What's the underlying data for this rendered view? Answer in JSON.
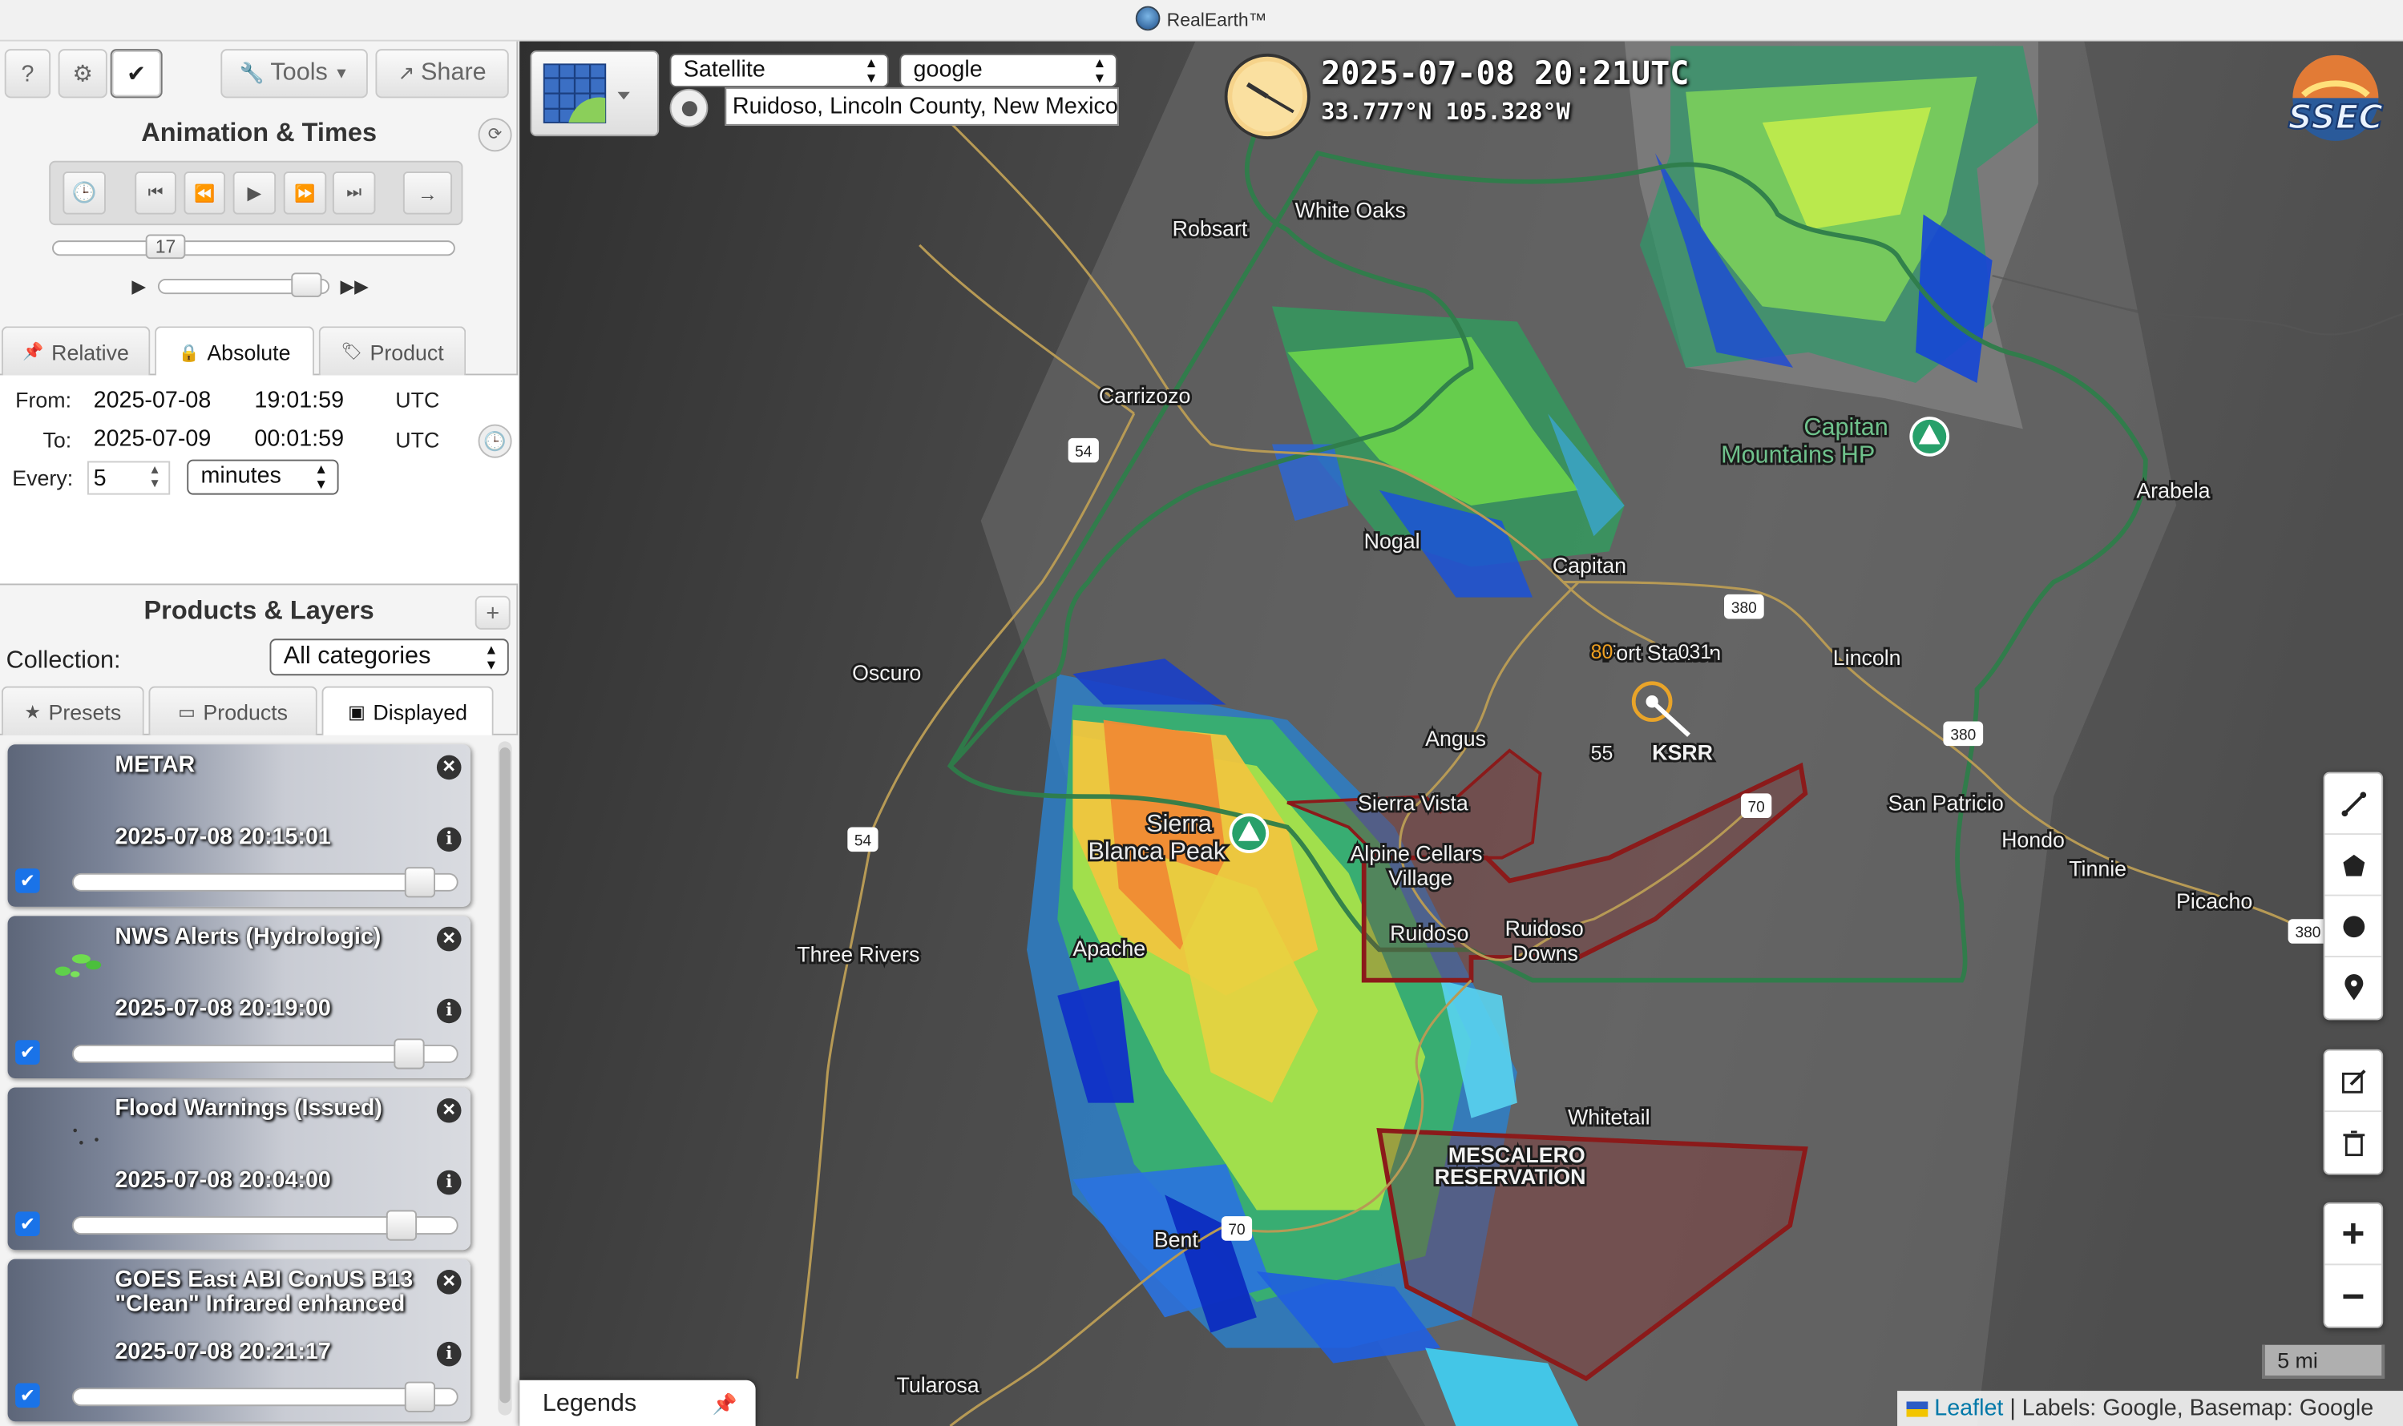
{
  "window": {
    "title": "RealEarth™"
  },
  "toolbar": {
    "help": "?",
    "settings": "⚙",
    "check": "✔",
    "tools": "Tools",
    "share": "Share"
  },
  "animation": {
    "title": "Animation & Times",
    "frame": "17",
    "tabs": [
      "Relative",
      "Absolute",
      "Product"
    ],
    "from_label": "From:",
    "to_label": "To:",
    "every_label": "Every:",
    "from_date": "2025-07-08",
    "from_time": "19:01:59",
    "to_date": "2025-07-09",
    "to_time": "00:01:59",
    "tz": "UTC",
    "every_value": "5",
    "every_unit": "minutes"
  },
  "products": {
    "title": "Products & Layers",
    "collection_label": "Collection:",
    "collection_value": "All categories",
    "tabs": [
      "Presets",
      "Products",
      "Displayed"
    ],
    "layers": [
      {
        "name": "METAR",
        "time": "2025-07-08 20:15:01",
        "opacity": 0.93
      },
      {
        "name": "NWS Alerts (Hydrologic)",
        "time": "2025-07-08 20:19:00",
        "opacity": 0.9
      },
      {
        "name": "Flood Warnings (Issued)",
        "time": "2025-07-08 20:04:00",
        "opacity": 0.88
      },
      {
        "name": "GOES East ABI ConUS B13 \"Clean\" Infrared enhanced",
        "time": "2025-07-08 20:21:17",
        "opacity": 0.93
      }
    ]
  },
  "map": {
    "basemap_type": "Satellite",
    "basemap_provider": "google",
    "location": "Ruidoso, Lincoln County, New Mexico",
    "timestamp": "2025-07-08  20:21UTC",
    "coords": "33.777°N 105.328°W",
    "logo": "SSEC",
    "scale": "5 mi",
    "legends": "Legends",
    "attribution_link": "Leaflet",
    "attribution_text": " | Labels: Google, Basemap: Google",
    "places": {
      "white_oaks": "White Oaks",
      "robsart": "Robsart",
      "carrizozo": "Carrizozo",
      "nogal": "Nogal",
      "capitan": "Capitan",
      "capitan_mtns": "Capitan",
      "capitan_mtns2": "Mountains HP",
      "arabela": "Arabela",
      "oscuro": "Oscuro",
      "fort_stanton": "Fort Stanton",
      "lincoln": "Lincoln",
      "angus": "Angus",
      "ksrr": "KSRR",
      "sierra_vista": "Sierra Vista",
      "sierra_blanca": "Sierra",
      "sierra_blanca2": "Blanca Peak",
      "alpine": "Alpine Cellars",
      "alpine2": "Village",
      "ruidoso": "Ruidoso",
      "ruidoso_downs": "Ruidoso",
      "ruidoso_downs2": "Downs",
      "san_patricio": "San Patricio",
      "hondo": "Hondo",
      "tinnie": "Tinnie",
      "picacho": "Picacho",
      "three_rivers": "Three Rivers",
      "apache": "Apache",
      "whitetail": "Whitetail",
      "mescalero": "MESCALERO",
      "mescalero2": "RESERVATION",
      "bent": "Bent",
      "tularosa": "Tularosa",
      "station_55": "55",
      "station_80": "80",
      "station_031": "031"
    },
    "shields": {
      "us54a": "54",
      "us54b": "54",
      "us380a": "380",
      "us380b": "380",
      "us380c": "380",
      "us70a": "70",
      "us70b": "70"
    },
    "colors": {
      "alert_fill": "#8b2a2a",
      "warning_outline": "#8b1a1a",
      "county_line": "#2e7d4a"
    }
  },
  "controls": {
    "draw_line": "line-icon",
    "draw_polygon": "polygon-icon",
    "draw_circle": "circle-icon",
    "draw_marker": "marker-icon",
    "edit": "edit-icon",
    "delete": "trash-icon",
    "zoom_in": "+",
    "zoom_out": "−"
  }
}
